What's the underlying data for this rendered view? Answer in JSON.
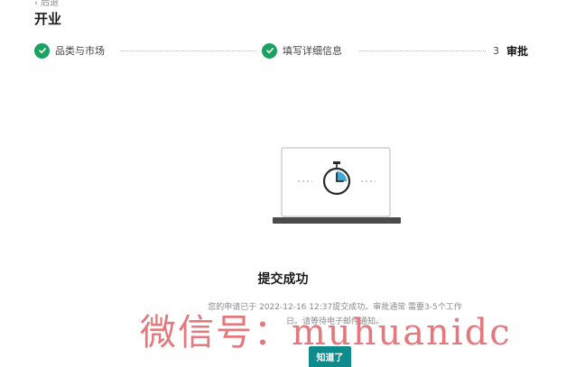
{
  "header": {
    "back_label": "后退",
    "title": "开业"
  },
  "stepper": {
    "steps": [
      {
        "label": "品类与市场",
        "status": "done"
      },
      {
        "label": "填写详细信息",
        "status": "done"
      },
      {
        "number": "3",
        "label": "审批",
        "status": "active"
      }
    ]
  },
  "colors": {
    "check_green": "#1aa260",
    "clock_accent": "#3fa8d6",
    "button_teal": "#0f8b8b",
    "watermark_red": "#e06b70"
  },
  "icons": {
    "done_step": "check-circle-icon",
    "illustration": "laptop-stopwatch-icon"
  },
  "result": {
    "title": "提交成功",
    "description_line1": "您的申请已于 2022-12-16 12:37提交成功。审批通常 需要3-5个工作",
    "description_line2": "日。请等待电子邮件通知。"
  },
  "actions": {
    "confirm_label": "知道了"
  },
  "watermark": {
    "text": "微信号：muhuanidc"
  }
}
